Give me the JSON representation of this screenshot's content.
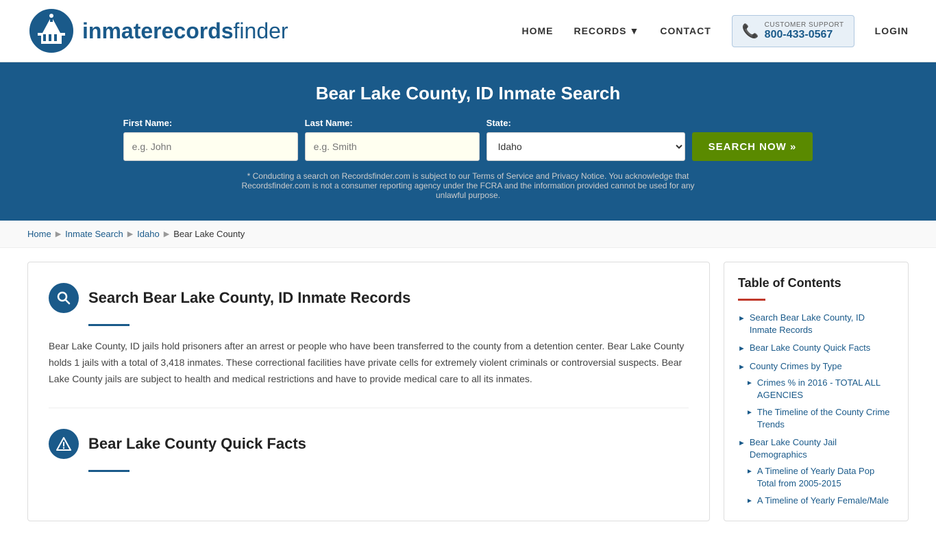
{
  "header": {
    "logo_text_light": "inmaterecords",
    "logo_text_bold": "finder",
    "nav": {
      "home": "HOME",
      "records": "RECORDS",
      "contact": "CONTACT",
      "login": "LOGIN"
    },
    "support": {
      "label": "CUSTOMER SUPPORT",
      "number": "800-433-0567"
    }
  },
  "hero": {
    "title": "Bear Lake County, ID Inmate Search",
    "first_name_label": "First Name:",
    "first_name_placeholder": "e.g. John",
    "last_name_label": "Last Name:",
    "last_name_placeholder": "e.g. Smith",
    "state_label": "State:",
    "state_value": "Idaho",
    "search_button": "SEARCH NOW »",
    "disclaimer": "* Conducting a search on Recordsfinder.com is subject to our Terms of Service and Privacy Notice. You acknowledge that Recordsfinder.com is not a consumer reporting agency under the FCRA and the information provided cannot be used for any unlawful purpose."
  },
  "breadcrumb": {
    "items": [
      "Home",
      "Inmate Search",
      "Idaho",
      "Bear Lake County"
    ]
  },
  "main": {
    "section1": {
      "title": "Search Bear Lake County, ID Inmate Records",
      "body": "Bear Lake County, ID jails hold prisoners after an arrest or people who have been transferred to the county from a detention center. Bear Lake County holds 1 jails with a total of 3,418 inmates. These correctional facilities have private cells for extremely violent criminals or controversial suspects. Bear Lake County jails are subject to health and medical restrictions and have to provide medical care to all its inmates."
    },
    "section2": {
      "title": "Bear Lake County Quick Facts"
    }
  },
  "toc": {
    "title": "Table of Contents",
    "items": [
      {
        "label": "Search Bear Lake County, ID Inmate Records",
        "sub": []
      },
      {
        "label": "Bear Lake County Quick Facts",
        "sub": []
      },
      {
        "label": "County Crimes by Type",
        "sub": [
          "Crimes % in 2016 - TOTAL ALL AGENCIES",
          "The Timeline of the County Crime Trends"
        ]
      },
      {
        "label": "Bear Lake County Jail Demographics",
        "sub": [
          "A Timeline of Yearly Data Pop Total from 2005-2015",
          "A Timeline of Yearly Female/Male"
        ]
      }
    ]
  }
}
